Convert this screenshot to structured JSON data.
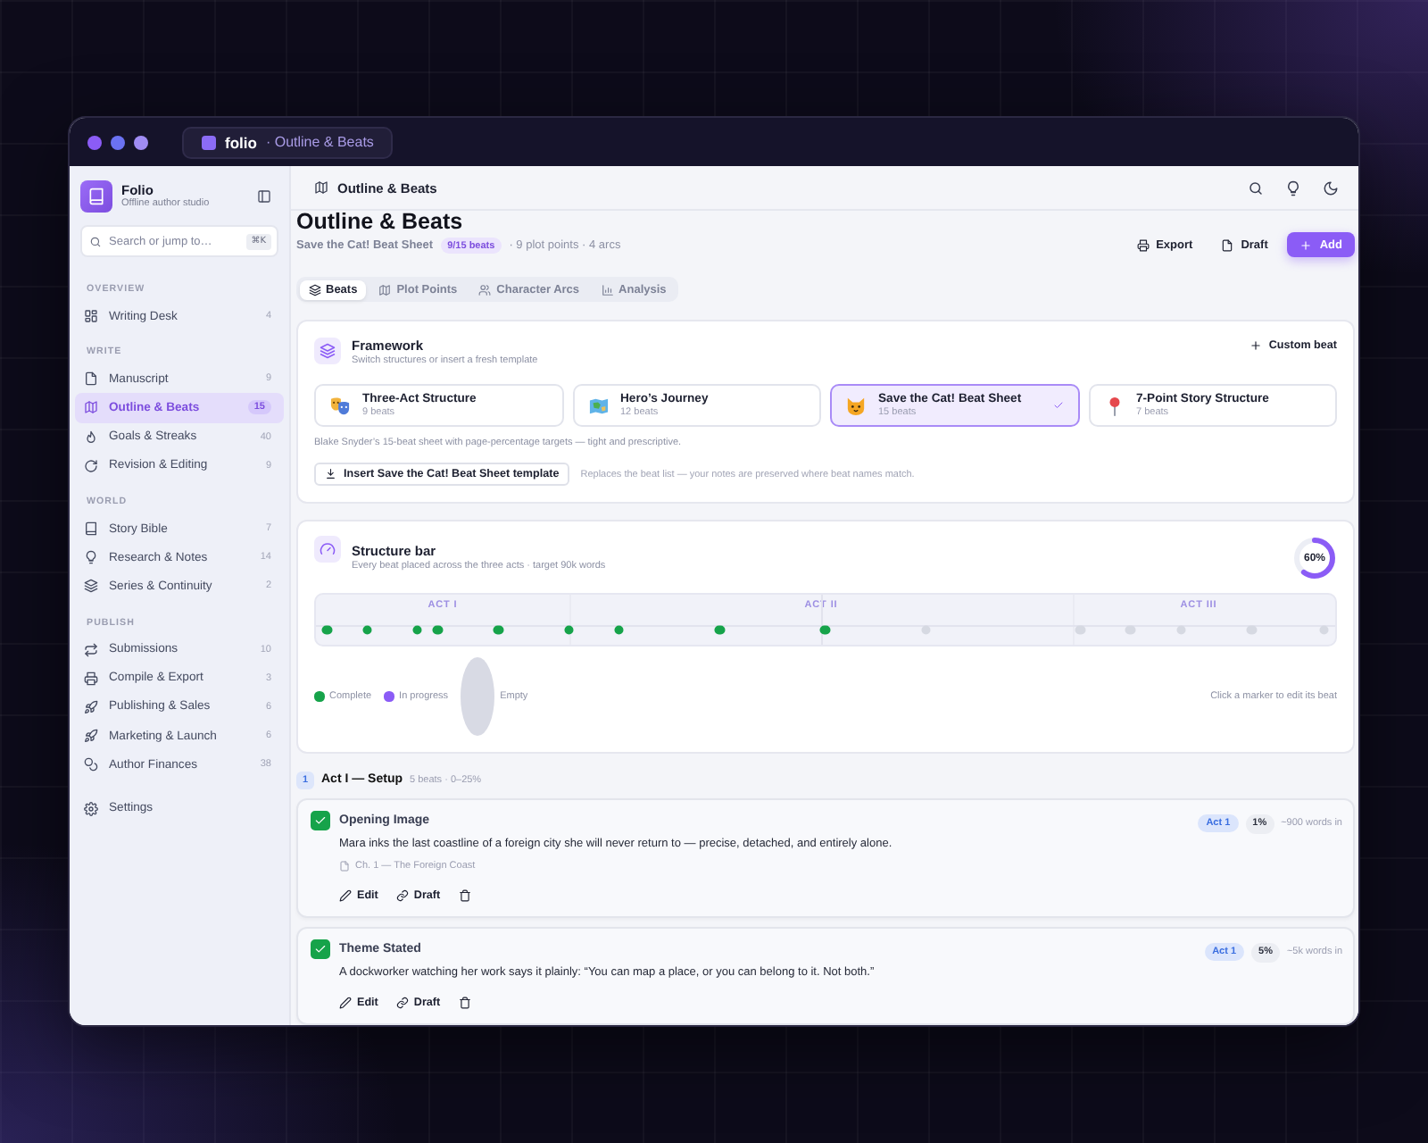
{
  "window": {
    "app_name": "folio",
    "tab_title": "· Outline & Beats"
  },
  "sidebar": {
    "brand": {
      "name": "Folio",
      "tagline": "Offline author studio"
    },
    "search": {
      "placeholder": "Search or jump to…",
      "shortcut": "⌘K"
    },
    "sections": [
      {
        "label": "OVERVIEW",
        "items": [
          {
            "label": "Writing Desk",
            "count": "4",
            "selected": false
          }
        ]
      },
      {
        "label": "WRITE",
        "items": [
          {
            "label": "Manuscript",
            "count": "9",
            "selected": false
          },
          {
            "label": "Outline & Beats",
            "count": "15",
            "selected": true
          },
          {
            "label": "Goals & Streaks",
            "count": "40",
            "selected": false
          },
          {
            "label": "Revision & Editing",
            "count": "9",
            "selected": false
          }
        ]
      },
      {
        "label": "WORLD",
        "items": [
          {
            "label": "Story Bible",
            "count": "7",
            "selected": false
          },
          {
            "label": "Research & Notes",
            "count": "14",
            "selected": false
          },
          {
            "label": "Series & Continuity",
            "count": "2",
            "selected": false
          }
        ]
      },
      {
        "label": "PUBLISH",
        "items": [
          {
            "label": "Submissions",
            "count": "10",
            "selected": false
          },
          {
            "label": "Compile & Export",
            "count": "3",
            "selected": false
          },
          {
            "label": "Publishing & Sales",
            "count": "6",
            "selected": false
          },
          {
            "label": "Marketing & Launch",
            "count": "6",
            "selected": false
          },
          {
            "label": "Author Finances",
            "count": "38",
            "selected": false
          }
        ]
      }
    ],
    "footer_items": [
      {
        "label": "Settings",
        "selected": false
      }
    ]
  },
  "header": {
    "title": "Outline & Beats"
  },
  "page": {
    "title": "Outline & Beats",
    "framework_name": "Save the Cat! Beat Sheet",
    "progress_badge": "9/15 beats",
    "meta": "· 9 plot points · 4 arcs",
    "actions": [
      {
        "label": "Export",
        "kind": "plain"
      },
      {
        "label": "Draft",
        "kind": "plain"
      },
      {
        "label": "Add",
        "kind": "primary"
      }
    ]
  },
  "tabs": [
    {
      "label": "Beats",
      "selected": true
    },
    {
      "label": "Plot Points",
      "selected": false
    },
    {
      "label": "Character Arcs",
      "selected": false
    },
    {
      "label": "Analysis",
      "selected": false
    }
  ],
  "framework": {
    "title": "Framework",
    "subtitle": "Switch structures or insert a fresh template",
    "custom_button": "Custom beat",
    "options": [
      {
        "name": "Three-Act Structure",
        "beats": "9 beats",
        "selected": false
      },
      {
        "name": "Hero’s Journey",
        "beats": "12 beats",
        "selected": false
      },
      {
        "name": "Save the Cat! Beat Sheet",
        "beats": "15 beats",
        "selected": true
      },
      {
        "name": "7-Point Story Structure",
        "beats": "7 beats",
        "selected": false
      }
    ],
    "description": "Blake Snyder’s 15-beat sheet with page-percentage targets — tight and prescriptive.",
    "insert_button": "Insert Save the Cat! Beat Sheet template",
    "insert_note": "Replaces the beat list — your notes are preserved where beat names match."
  },
  "structure": {
    "title": "Structure bar",
    "subtitle": "Every beat placed across the three acts · target 90k words",
    "ring": {
      "label": "60%",
      "level": 0.6
    },
    "acts": [
      "ACT I",
      "ACT II",
      "ACT III"
    ],
    "markers": [
      {
        "level": 0.01,
        "complete": true
      },
      {
        "level": 0.05,
        "complete": true
      },
      {
        "level": 0.1,
        "complete": true
      },
      {
        "level": 0.12,
        "complete": true
      },
      {
        "level": 0.18,
        "complete": true
      },
      {
        "level": 0.25,
        "complete": true
      },
      {
        "level": 0.3,
        "complete": true
      },
      {
        "level": 0.4,
        "complete": true
      },
      {
        "level": 0.505,
        "complete": true
      },
      {
        "level": 0.605,
        "complete": false
      },
      {
        "level": 0.758,
        "complete": false
      },
      {
        "level": 0.808,
        "complete": false
      },
      {
        "level": 0.859,
        "complete": false
      },
      {
        "level": 0.929,
        "complete": false
      },
      {
        "level": 1,
        "complete": false
      }
    ],
    "legend": [
      {
        "label": "Complete",
        "kind": "dot",
        "color": "#16a34a"
      },
      {
        "label": "In progress",
        "kind": "dot",
        "color": "#8b5cf6"
      },
      {
        "label": "Empty",
        "kind": "oval",
        "color": "#d8dae4"
      }
    ],
    "hint": "Click a marker to edit its beat"
  },
  "act": {
    "number": "1",
    "title": "Act I — Setup",
    "meta": "5 beats · 0–25%",
    "beats": [
      {
        "title": "Opening Image",
        "checked": true,
        "act_badge": "Act 1",
        "percent": "1%",
        "words": "~900 words in",
        "summary": "Mara inks the last coastline of a foreign city she will never return to — precise, detached, and entirely alone.",
        "chapter": "Ch. 1 — The Foreign Coast",
        "actions": [
          {
            "kind": "edit",
            "label": "Edit"
          },
          {
            "kind": "draft",
            "label": "Draft"
          },
          {
            "kind": "delete"
          }
        ]
      },
      {
        "title": "Theme Stated",
        "checked": true,
        "act_badge": "Act 1",
        "percent": "5%",
        "words": "~5k words in",
        "summary": "A dockworker watching her work says it plainly: “You can map a place, or you can belong to it. Not both.”",
        "actions": [
          {
            "kind": "edit",
            "label": "Edit"
          },
          {
            "kind": "draft",
            "label": "Draft"
          },
          {
            "kind": "delete"
          }
        ]
      }
    ]
  }
}
